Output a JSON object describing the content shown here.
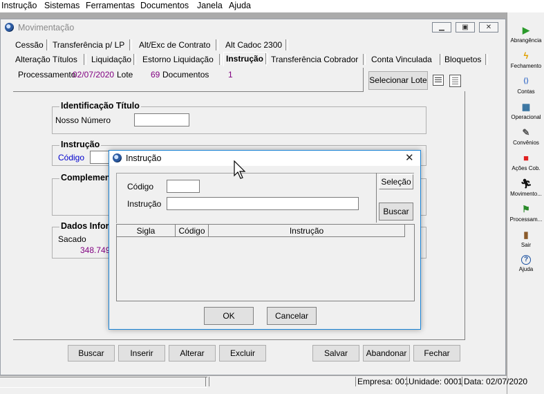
{
  "menu": [
    "Instrução",
    "Sistemas",
    "Ferramentas",
    "Documentos",
    "Janela",
    "Ajuda"
  ],
  "toolbar": [
    {
      "label": "Abrangência",
      "icon": "play-green-icon"
    },
    {
      "label": "Fechamento",
      "icon": "lightning-icon"
    },
    {
      "label": "Contas",
      "icon": "link-arrows-icon"
    },
    {
      "label": "Operacional",
      "icon": "calculator-icon"
    },
    {
      "label": "Convênios",
      "icon": "document-check-icon"
    },
    {
      "label": "Ações Cob.",
      "icon": "red-square-icon"
    },
    {
      "label": "Movimento...",
      "icon": "running-man-icon"
    },
    {
      "label": "Processam...",
      "icon": "flag-icon"
    },
    {
      "label": "Sair",
      "icon": "exit-door-icon"
    },
    {
      "label": "Ajuda",
      "icon": "help-icon"
    }
  ],
  "window": {
    "title": "Movimentação",
    "tabs_row1": [
      "Cessão",
      "Transferência p/ LP",
      "Alt/Exc de Contrato",
      "Alt Cadoc 2300"
    ],
    "tabs_row2": [
      "Alteração Títulos",
      "Liquidação",
      "Estorno Liquidação",
      "Instrução",
      "Transferência Cobrador",
      "Conta Vinculada",
      "Bloquetos"
    ],
    "active_tab": "Instrução",
    "processamento_label": "Processamento",
    "processamento_value": "02/07/2020",
    "lote_label": "Lote",
    "lote_value": "69",
    "documentos_label": "Documentos",
    "documentos_value": "1",
    "selecionar_lote": "Selecionar Lote",
    "group_identificacao": "Identificação Título",
    "nosso_numero_label": "Nosso Número",
    "group_instrucao": "Instrução",
    "codigo_label": "Código",
    "group_complemento": "Complemento",
    "group_dados": "Dados Inform",
    "sacado_label": "Sacado",
    "sacado_value": "348.749.",
    "buttons": [
      "Buscar",
      "Inserir",
      "Alterar",
      "Excluir",
      "Salvar",
      "Abandonar",
      "Fechar"
    ]
  },
  "dialog": {
    "title": "Instrução",
    "codigo_label": "Código",
    "instrucao_label": "Instrução",
    "selecao_label": "Seleção",
    "buscar_label": "Buscar",
    "columns": [
      "Sigla",
      "Código",
      "Instrução"
    ],
    "ok_label": "OK",
    "cancelar_label": "Cancelar"
  },
  "status": {
    "empresa": "Empresa: 001",
    "unidade": "Unidade: 0001",
    "data": "Data:  02/07/2020"
  }
}
